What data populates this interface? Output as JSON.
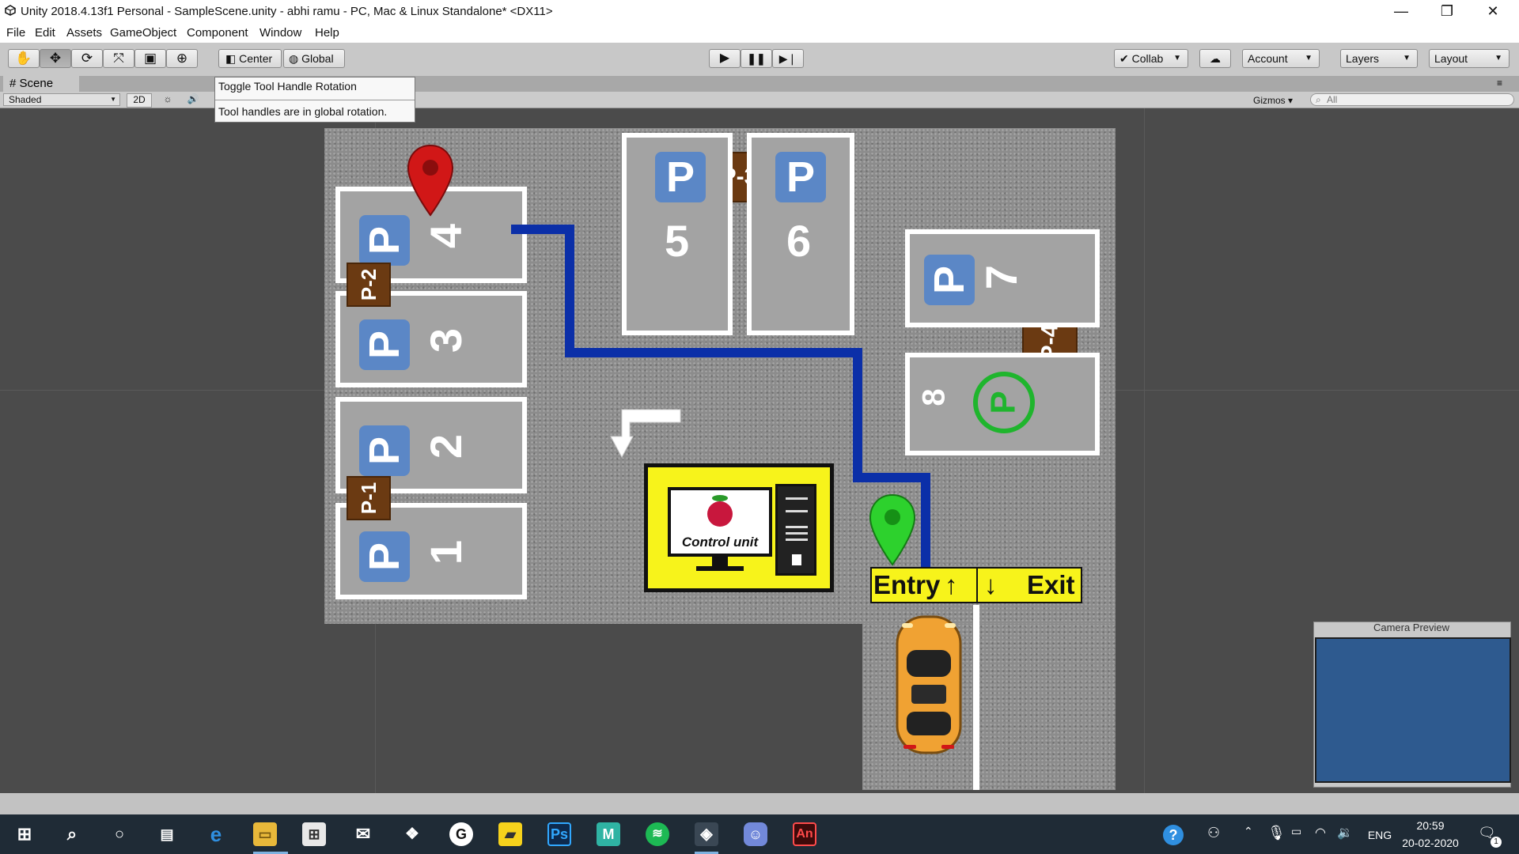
{
  "window": {
    "title": "Unity 2018.4.13f1 Personal - SampleScene.unity - abhi ramu - PC, Mac & Linux Standalone* <DX11>"
  },
  "menu": [
    "File",
    "Edit",
    "Assets",
    "GameObject",
    "Component",
    "Window",
    "Help"
  ],
  "toolbar": {
    "pivot_label": "Center",
    "space_label": "Global",
    "collab_label": "Collab",
    "account_label": "Account",
    "layers_label": "Layers",
    "layout_label": "Layout"
  },
  "scene": {
    "tab_label": "Scene",
    "shading_mode": "Shaded",
    "mode_2d": "2D",
    "gizmos_label": "Gizmos",
    "search_placeholder": "All"
  },
  "tooltip": {
    "line1": "Toggle Tool Handle Rotation",
    "line2": "Tool handles are in global rotation."
  },
  "parking": {
    "slots": [
      "1",
      "2",
      "3",
      "4",
      "5",
      "6",
      "7",
      "8"
    ],
    "zones": [
      "P-1",
      "P-2",
      "P-3",
      "P-4"
    ],
    "sign_letter": "P",
    "control_unit_label": "Control unit",
    "entry_label": "Entry",
    "exit_label": "Exit"
  },
  "camera_preview": {
    "title": "Camera Preview"
  },
  "taskbar": {
    "language": "ENG",
    "time": "20:59",
    "date": "20-02-2020",
    "notification_count": "1",
    "app_ps": "Ps",
    "app_an": "An",
    "app_m": "M"
  }
}
